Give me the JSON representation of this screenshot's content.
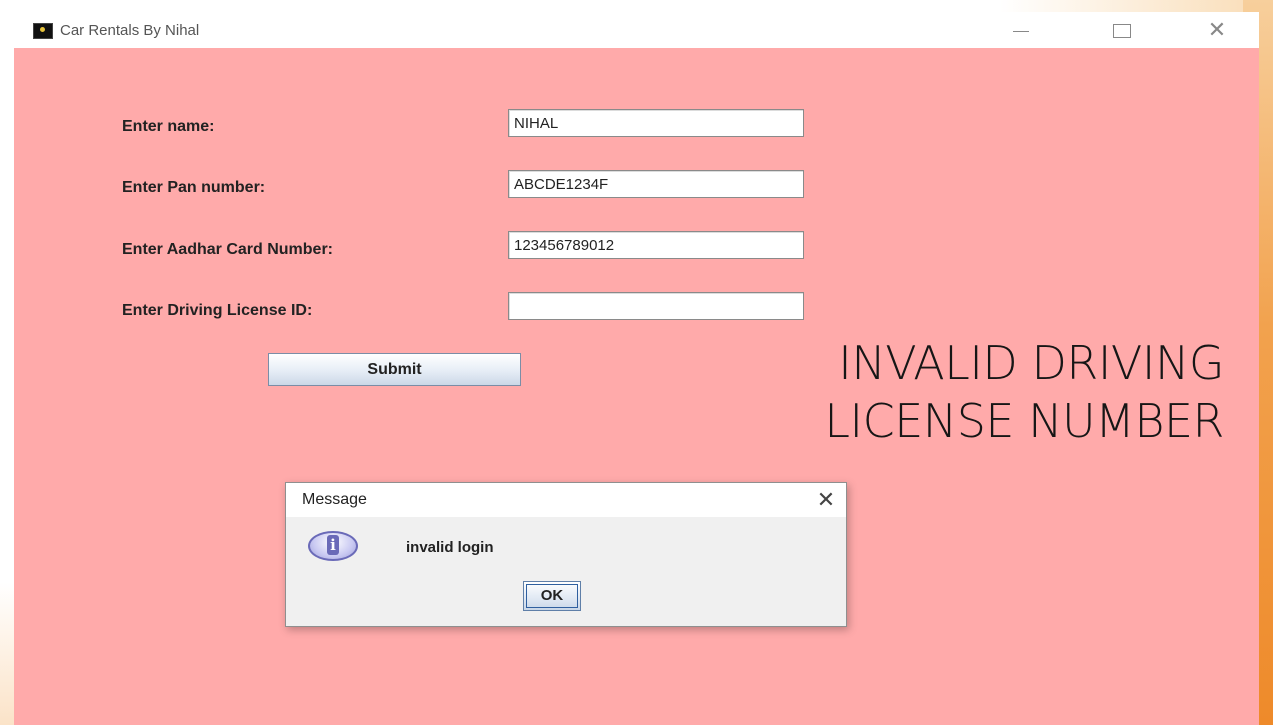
{
  "window": {
    "title": "Car Rentals By Nihal",
    "controls": {
      "minimize": "minimize",
      "maximize": "maximize",
      "close": "close"
    }
  },
  "form": {
    "fields": [
      {
        "label": "Enter name:",
        "value": "NIHAL"
      },
      {
        "label": "Enter Pan number:",
        "value": "ABCDE1234F"
      },
      {
        "label": "Enter Aadhar Card Number:",
        "value": "123456789012"
      },
      {
        "label": "Enter Driving License ID:",
        "value": ""
      }
    ],
    "submit_label": "Submit"
  },
  "overlay": {
    "line1": "INVALID DRIVING",
    "line2": "LICENSE NUMBER"
  },
  "dialog": {
    "title": "Message",
    "message": "invalid login",
    "ok_label": "OK",
    "icon": "info-icon"
  },
  "colors": {
    "window_background": "#ffaaaa",
    "slide_accent": "#ee8a2a"
  }
}
